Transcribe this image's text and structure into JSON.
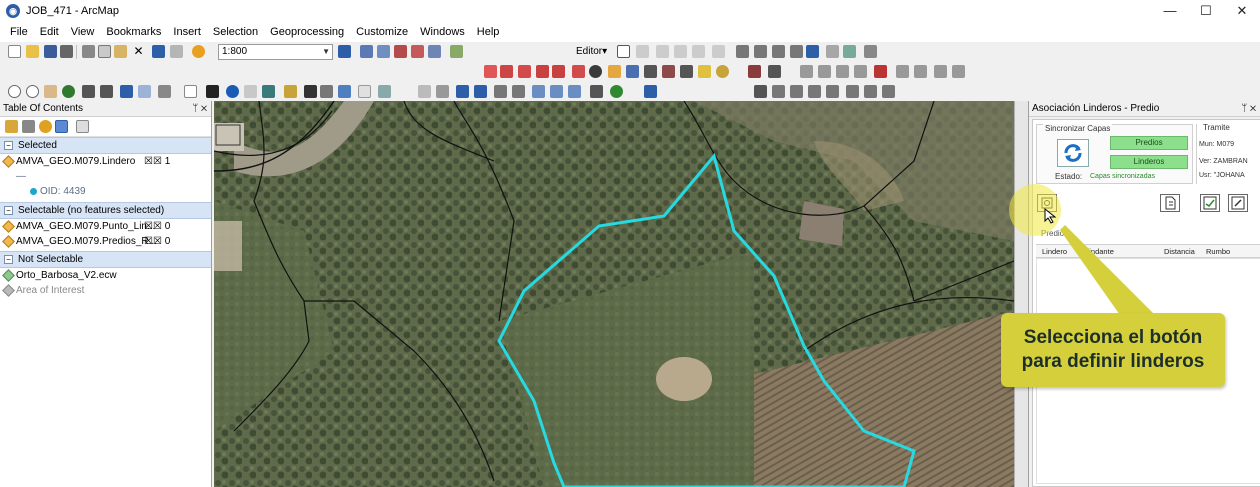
{
  "window": {
    "title": "JOB_471 - ArcMap",
    "min": "—",
    "max": "☐",
    "close": "✕"
  },
  "menu": [
    "File",
    "Edit",
    "View",
    "Bookmarks",
    "Insert",
    "Selection",
    "Geoprocessing",
    "Customize",
    "Windows",
    "Help"
  ],
  "toolbar": {
    "scale": "1:800",
    "editor_label": "Editor▾"
  },
  "toc": {
    "title": "Table Of Contents",
    "pin": "ᛘ ✕",
    "groups": {
      "selected": "Selected",
      "selectable": "Selectable (no features selected)",
      "not_selectable": "Not Selectable"
    },
    "layers": {
      "lindero": {
        "name": "AMVA_GEO.M079.Lindero",
        "count": "1"
      },
      "lindero_sub": "—",
      "oid": "OID: 4439",
      "punto": {
        "name": "AMVA_GEO.M079.Punto_Lin...",
        "count": "0"
      },
      "predios": {
        "name": "AMVA_GEO.M079.Predios_R...",
        "count": "0"
      },
      "orto": "Orto_Barbosa_V2.ecw",
      "area": "Area of Interest"
    }
  },
  "assoc": {
    "title": "Asociación Linderos - Predio",
    "pin": "ᛘ ✕",
    "sync_legend": "Sincronizar Capas",
    "predios_btn": "Predios",
    "linderos_btn": "Linderos",
    "estado_label": "Estado:",
    "estado_value": "Capas sincronizadas",
    "tramite_title": "Tramite",
    "mun": "Mun:  M079",
    "ver": "Ver:  ZAMBRAN",
    "usr": "Usr:  \"JOHANA",
    "predio_label": "Predio:",
    "columns": [
      "Lindero",
      "Colindante",
      "Distancia",
      "Rumbo"
    ]
  },
  "callout": {
    "line1": "Selecciona el botón",
    "line2": "para definir linderos"
  },
  "colors": {
    "callout_bg": "#d4cf3b",
    "parcel_outline": "#27d9e0",
    "green_btn": "#8ce08c"
  }
}
